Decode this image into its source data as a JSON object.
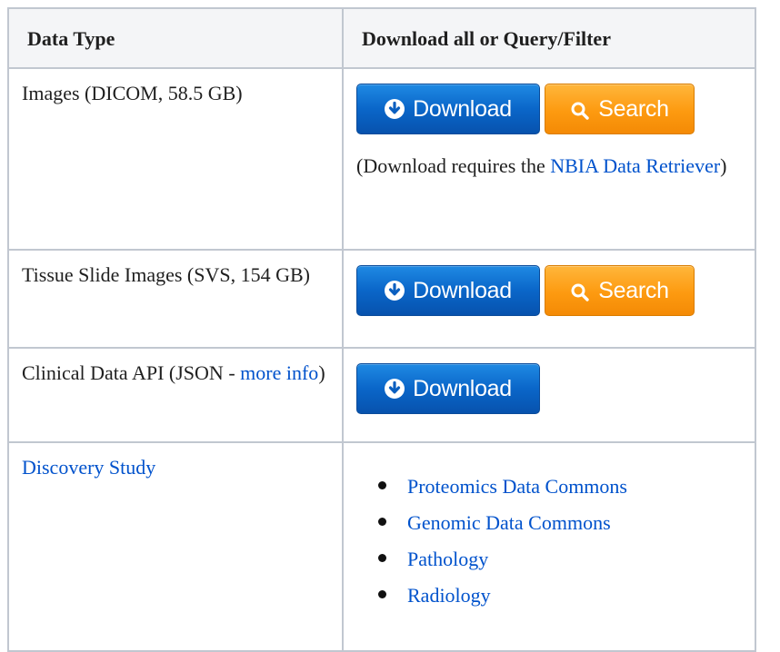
{
  "table": {
    "headers": {
      "data_type": "Data Type",
      "download": "Download all or Query/Filter"
    },
    "rows": [
      {
        "label": "Images (DICOM, 58.5 GB)",
        "download_label": "Download",
        "search_label": "Search",
        "note_prefix": "(Download requires the ",
        "note_link": "NBIA Data Retriever",
        "note_suffix": ")"
      },
      {
        "label": "Tissue Slide Images (SVS, 154 GB)",
        "download_label": "Download",
        "search_label": "Search"
      },
      {
        "label_prefix": "Clinical Data API (JSON - ",
        "label_link": "more info",
        "label_suffix": ")",
        "download_label": "Download"
      },
      {
        "label_link": "Discovery Study",
        "links": [
          "Proteomics Data Commons",
          "Genomic Data Commons",
          "Pathology",
          "Radiology"
        ]
      }
    ]
  },
  "colors": {
    "link": "#0052cc",
    "download_button": "#0a66c9",
    "search_button": "#fd9a10",
    "header_bg": "#f4f5f7",
    "border": "#c1c7d0"
  },
  "icons": {
    "download": "circle-arrow-down-icon",
    "search": "magnifier-icon"
  }
}
